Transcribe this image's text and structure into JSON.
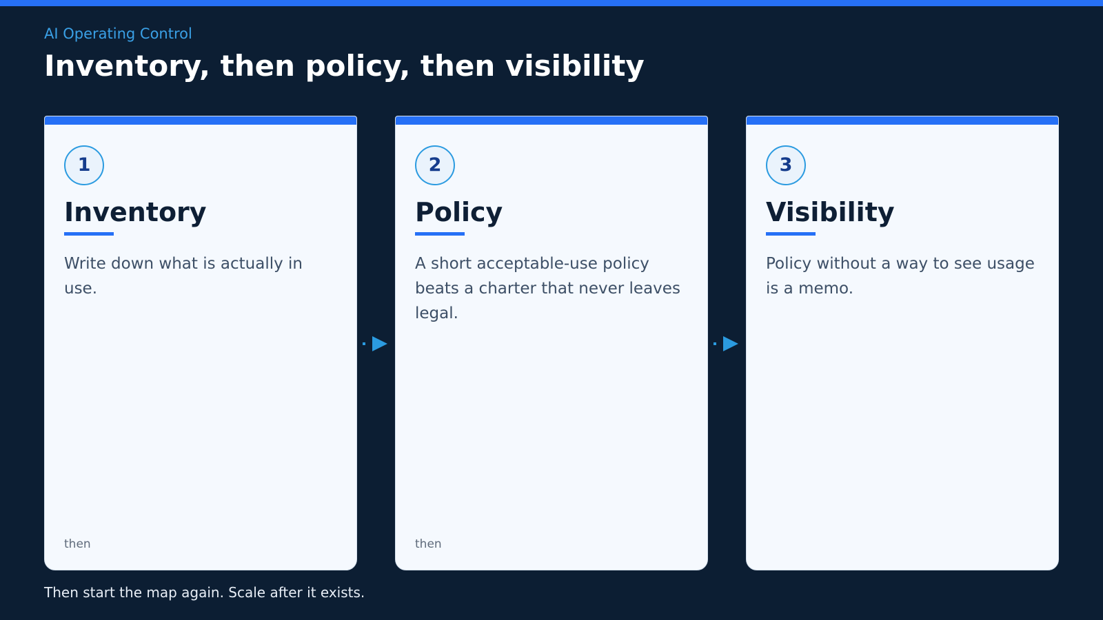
{
  "colors": {
    "background": "#0c1e33",
    "accent": "#2670f6",
    "eyebrow": "#3aa0e6",
    "card": "#f5f9fe",
    "step_ring": "#2b9be0",
    "step_number": "#153c8c"
  },
  "header": {
    "eyebrow": "AI Operating Control",
    "title": "Inventory, then policy, then visibility"
  },
  "steps": [
    {
      "number": "1",
      "title": "Inventory",
      "body": "Write down what is actually in use.",
      "footer": "then"
    },
    {
      "number": "2",
      "title": "Policy",
      "body": "A short acceptable-use policy beats a charter that never leaves legal.",
      "footer": "then"
    },
    {
      "number": "3",
      "title": "Visibility",
      "body": "Policy without a way to see usage is a memo.",
      "footer": ""
    }
  ],
  "connectors": [
    {
      "icon": "arrow-right-icon"
    },
    {
      "icon": "arrow-right-icon"
    }
  ],
  "footnote": "Then start the map again. Scale after it exists."
}
